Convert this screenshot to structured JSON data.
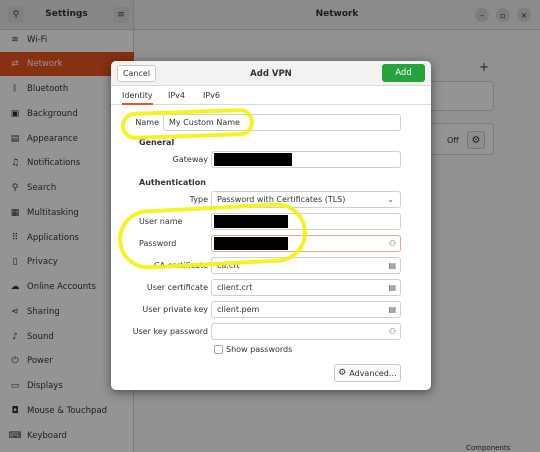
{
  "settings": {
    "sidebar_title": "Settings",
    "page_title": "Network",
    "items": [
      {
        "label": "Wi-Fi",
        "icon": "wifi-icon",
        "glyph": "≋"
      },
      {
        "label": "Network",
        "icon": "network-icon",
        "glyph": "⇄"
      },
      {
        "label": "Bluetooth",
        "icon": "bluetooth-icon",
        "glyph": "ᛒ"
      },
      {
        "label": "Background",
        "icon": "background-icon",
        "glyph": "▣"
      },
      {
        "label": "Appearance",
        "icon": "appearance-icon",
        "glyph": "▤"
      },
      {
        "label": "Notifications",
        "icon": "bell-icon",
        "glyph": "♫"
      },
      {
        "label": "Search",
        "icon": "search-icon",
        "glyph": "⚲"
      },
      {
        "label": "Multitasking",
        "icon": "multitasking-icon",
        "glyph": "▦"
      },
      {
        "label": "Applications",
        "icon": "applications-icon",
        "glyph": "⠿"
      },
      {
        "label": "Privacy",
        "icon": "privacy-icon",
        "glyph": "▯"
      },
      {
        "label": "Online Accounts",
        "icon": "online-accounts-icon",
        "glyph": "☁"
      },
      {
        "label": "Sharing",
        "icon": "sharing-icon",
        "glyph": "⋖"
      },
      {
        "label": "Sound",
        "icon": "sound-icon",
        "glyph": "♪"
      },
      {
        "label": "Power",
        "icon": "power-icon",
        "glyph": "⏻"
      },
      {
        "label": "Displays",
        "icon": "displays-icon",
        "glyph": "▭"
      },
      {
        "label": "Mouse & Touchpad",
        "icon": "mouse-icon",
        "glyph": "◘"
      },
      {
        "label": "Keyboard",
        "icon": "keyboard-icon",
        "glyph": "⌨"
      }
    ],
    "active_item": "Network",
    "vpn_toggle_state": "Off",
    "bottom_cut_text": "Components",
    "accent_color": "#e95420"
  },
  "dialog": {
    "title": "Add VPN",
    "cancel_label": "Cancel",
    "add_label": "Add",
    "add_color": "#26a33c",
    "tabs": [
      "Identity",
      "IPv4",
      "IPv6"
    ],
    "active_tab": "Identity",
    "name_label": "Name",
    "name_value": "My Custom Name",
    "general_heading": "General",
    "gateway_label": "Gateway",
    "auth_heading": "Authentication",
    "type_label": "Type",
    "type_value": "Password with Certificates (TLS)",
    "username_label": "User name",
    "password_label": "Password",
    "ca_label": "CA certificate",
    "ca_value": "ca.crt",
    "usercert_label": "User certificate",
    "usercert_value": "client.crt",
    "userkey_label": "User private key",
    "userkey_value": "client.pem",
    "keypw_label": "User key password",
    "show_passwords_label": "Show passwords",
    "show_passwords_checked": false,
    "advanced_label": "Advanced…"
  },
  "annotation_color": "#f3f21a"
}
